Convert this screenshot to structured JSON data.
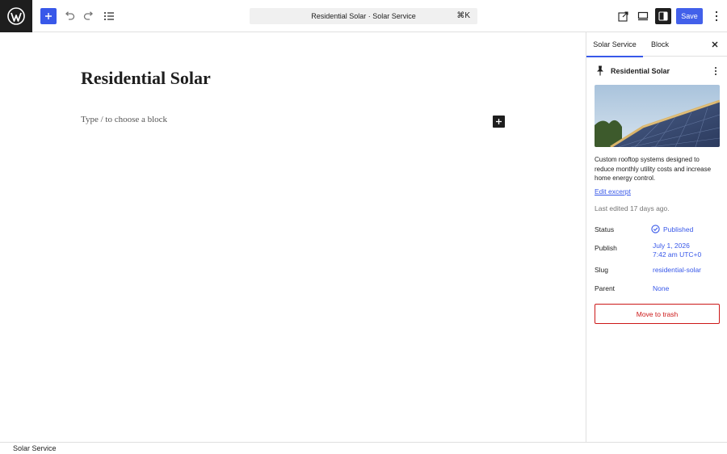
{
  "toolbar": {
    "document_title": "Residential Solar · Solar Service",
    "shortcut": "⌘K",
    "save_label": "Save",
    "icons": [
      "wordpress-logo",
      "plus-icon",
      "undo-icon",
      "redo-icon",
      "list-view-icon",
      "view-icon",
      "preview-icon",
      "settings-sidebar-icon",
      "more-options-icon"
    ]
  },
  "editor": {
    "title": "Residential Solar",
    "placeholder": "Type / to choose a block"
  },
  "sidebar": {
    "tabs": [
      {
        "label": "Solar Service",
        "active": true
      },
      {
        "label": "Block",
        "active": false
      }
    ],
    "post": {
      "name": "Residential Solar",
      "excerpt": "Custom rooftop systems designed to reduce monthly utility costs and increase home energy control.",
      "edit_excerpt": "Edit excerpt",
      "last_edited": "Last edited 17 days ago."
    },
    "status": {
      "label": "Status",
      "value": "Published"
    },
    "publish": {
      "label": "Publish",
      "date": "July 1, 2026",
      "time": "7:42 am UTC+0"
    },
    "slug": {
      "label": "Slug",
      "value": "residential-solar"
    },
    "parent": {
      "label": "Parent",
      "value": "None"
    },
    "trash_label": "Move to trash"
  },
  "footer": {
    "breadcrumb": "Solar Service"
  },
  "colors": {
    "accent": "#3858e9",
    "dark": "#1e1e1e",
    "danger": "#cc1818"
  }
}
